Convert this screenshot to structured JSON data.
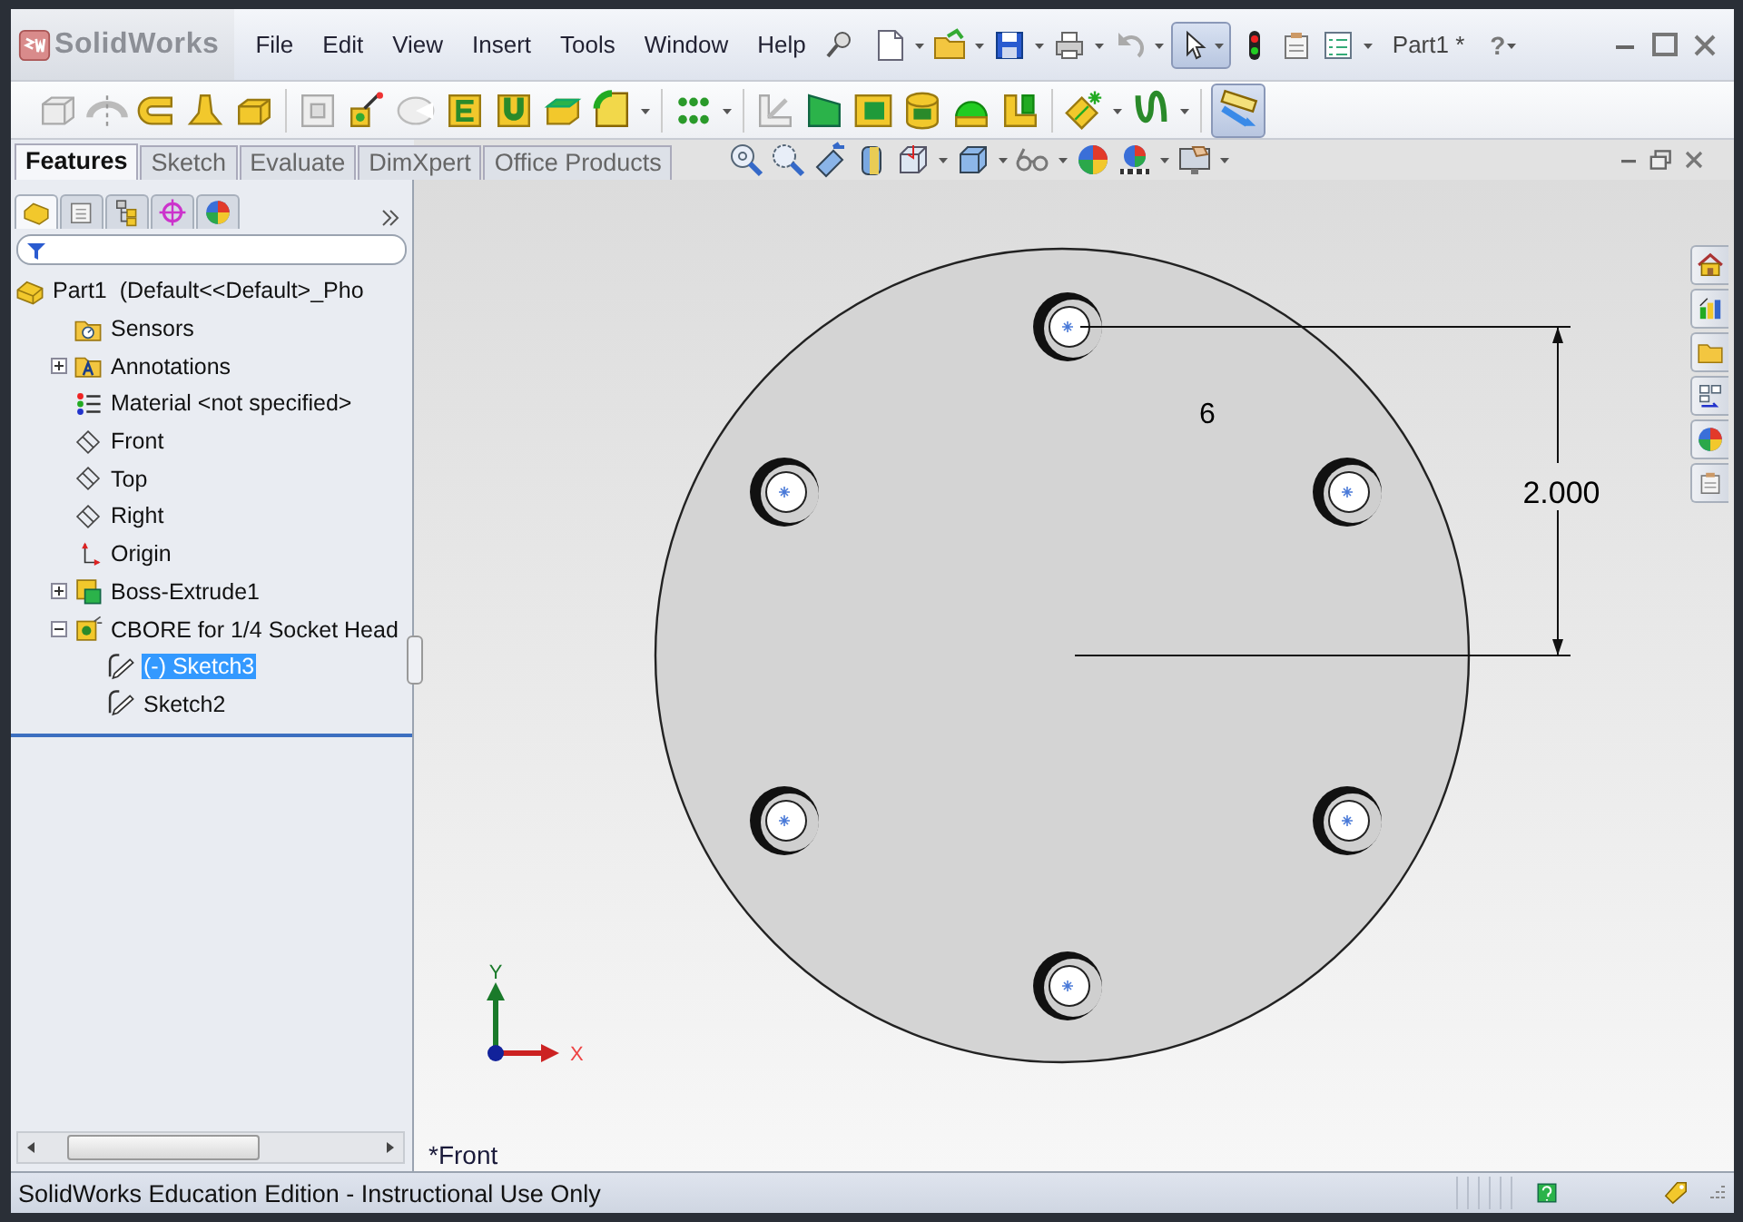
{
  "app": {
    "logo_text": "SolidWorks"
  },
  "menu": [
    {
      "label": "File"
    },
    {
      "label": "Edit"
    },
    {
      "label": "View"
    },
    {
      "label": "Insert"
    },
    {
      "label": "Tools"
    },
    {
      "label": "Window"
    },
    {
      "label": "Help"
    }
  ],
  "quick_access": {
    "select_active": true
  },
  "document_title": "Part1 *",
  "help_button": "?",
  "features_toolbar": {
    "measure_active": true
  },
  "command_tabs": [
    {
      "label": "Features",
      "selected": true
    },
    {
      "label": "Sketch",
      "selected": false
    },
    {
      "label": "Evaluate",
      "selected": false
    },
    {
      "label": "DimXpert",
      "selected": false
    },
    {
      "label": "Office Products",
      "selected": false
    }
  ],
  "panel_tabs": [
    {
      "selected": true
    },
    {
      "selected": false
    },
    {
      "selected": false
    },
    {
      "selected": false
    },
    {
      "selected": false
    }
  ],
  "feature_tree": {
    "root": {
      "label": "Part1  (Default<<Default>_Pho",
      "kind": "part",
      "selected": false,
      "children": [
        {
          "label": "Sensors",
          "kind": "sensors",
          "selected": false
        },
        {
          "label": "Annotations",
          "kind": "annotations",
          "selected": false,
          "expanded": false
        },
        {
          "label": "Material <not specified>",
          "kind": "material",
          "selected": false
        },
        {
          "label": "Front",
          "kind": "plane",
          "selected": false
        },
        {
          "label": "Top",
          "kind": "plane",
          "selected": false
        },
        {
          "label": "Right",
          "kind": "plane",
          "selected": false
        },
        {
          "label": "Origin",
          "kind": "origin",
          "selected": false
        },
        {
          "label": "Boss-Extrude1",
          "kind": "extrude",
          "selected": false,
          "expanded": false
        },
        {
          "label": "CBORE for 1/4 Socket Head",
          "kind": "hole",
          "selected": false,
          "expanded": true,
          "children": [
            {
              "label": "(-) Sketch3",
              "kind": "sketch",
              "selected": true
            },
            {
              "label": "Sketch2",
              "kind": "sketch",
              "selected": false
            }
          ]
        }
      ]
    }
  },
  "viewport": {
    "view_name": "*Front",
    "dimension_value": "2.000",
    "hole_count_note": "6",
    "axis_labels": {
      "y": "Y",
      "x": "X"
    }
  },
  "status_bar": {
    "text": "SolidWorks Education Edition - Instructional Use Only"
  }
}
